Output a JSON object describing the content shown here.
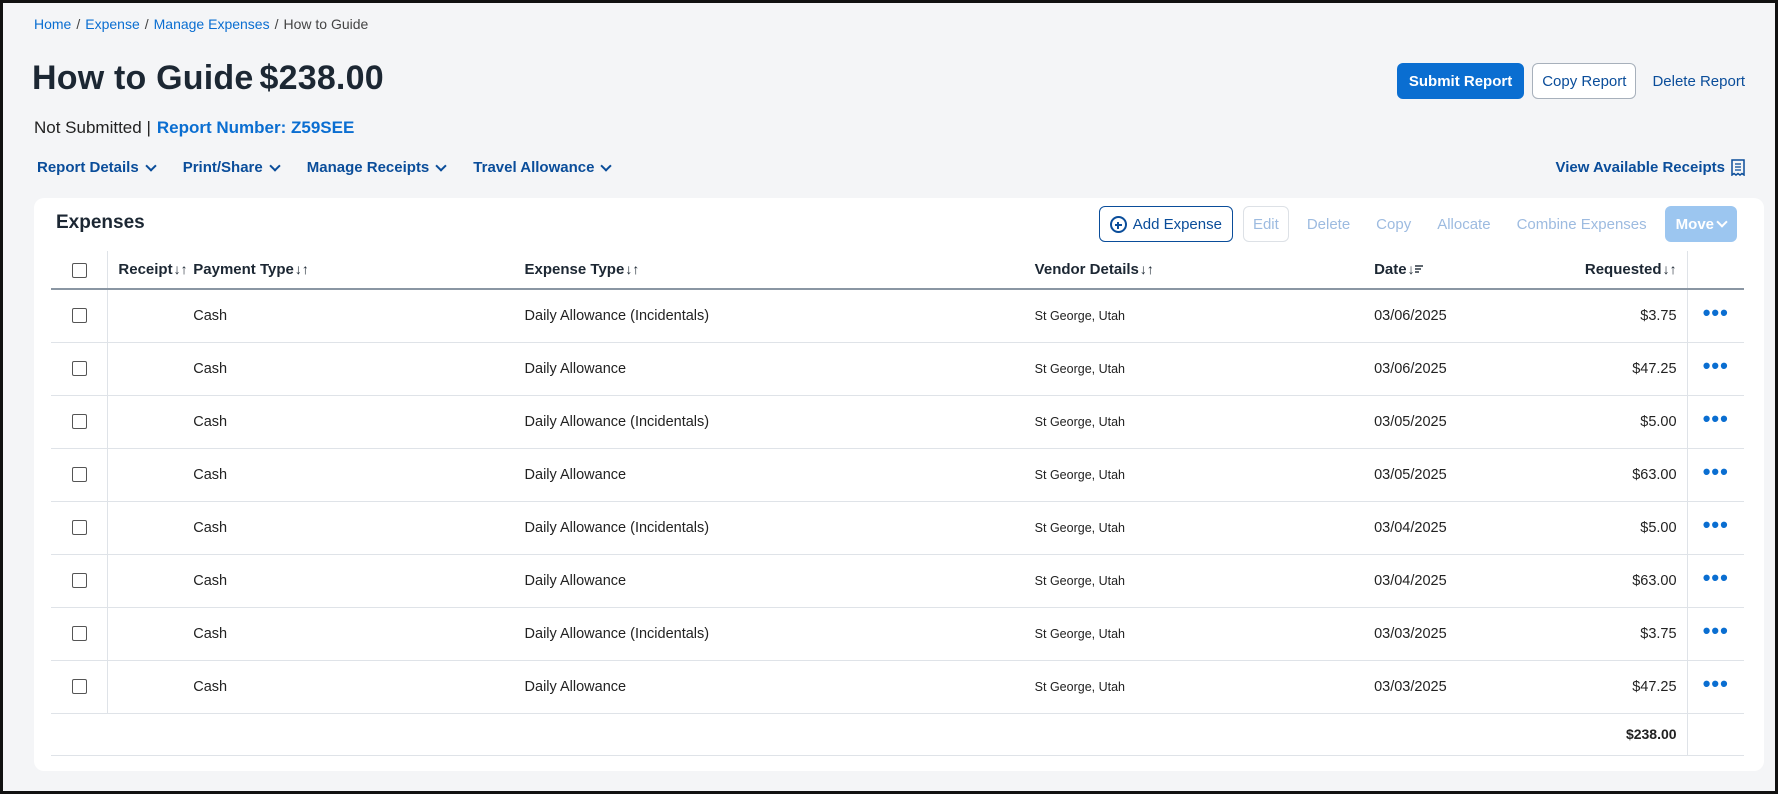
{
  "breadcrumb": {
    "items": [
      "Home",
      "Expense",
      "Manage Expenses"
    ],
    "current": "How to Guide"
  },
  "report": {
    "title": "How to Guide",
    "amount": "$238.00",
    "status": "Not Submitted |",
    "number_label": "Report Number: Z59SEE"
  },
  "actions": {
    "submit": "Submit Report",
    "copy": "Copy Report",
    "delete": "Delete Report"
  },
  "menus": [
    "Report Details",
    "Print/Share",
    "Manage Receipts",
    "Travel Allowance"
  ],
  "view_receipts": "View Available Receipts",
  "expenses": {
    "title": "Expenses",
    "toolbar": {
      "add": "Add Expense",
      "edit": "Edit",
      "delete": "Delete",
      "copy": "Copy",
      "allocate": "Allocate",
      "combine": "Combine Expenses",
      "move": "Move"
    },
    "columns": {
      "receipt": "Receipt",
      "payment_type": "Payment Type",
      "expense_type": "Expense Type",
      "vendor": "Vendor Details",
      "date": "Date",
      "requested": "Requested"
    },
    "sort_glyphs": {
      "both": "↓↑",
      "desc": "↓"
    },
    "rows": [
      {
        "payment": "Cash",
        "type": "Daily Allowance (Incidentals)",
        "vendor": "St George, Utah",
        "date": "03/06/2025",
        "amount": "$3.75"
      },
      {
        "payment": "Cash",
        "type": "Daily Allowance",
        "vendor": "St George, Utah",
        "date": "03/06/2025",
        "amount": "$47.25"
      },
      {
        "payment": "Cash",
        "type": "Daily Allowance (Incidentals)",
        "vendor": "St George, Utah",
        "date": "03/05/2025",
        "amount": "$5.00"
      },
      {
        "payment": "Cash",
        "type": "Daily Allowance",
        "vendor": "St George, Utah",
        "date": "03/05/2025",
        "amount": "$63.00"
      },
      {
        "payment": "Cash",
        "type": "Daily Allowance (Incidentals)",
        "vendor": "St George, Utah",
        "date": "03/04/2025",
        "amount": "$5.00"
      },
      {
        "payment": "Cash",
        "type": "Daily Allowance",
        "vendor": "St George, Utah",
        "date": "03/04/2025",
        "amount": "$63.00"
      },
      {
        "payment": "Cash",
        "type": "Daily Allowance (Incidentals)",
        "vendor": "St George, Utah",
        "date": "03/03/2025",
        "amount": "$3.75"
      },
      {
        "payment": "Cash",
        "type": "Daily Allowance",
        "vendor": "St George, Utah",
        "date": "03/03/2025",
        "amount": "$47.25"
      }
    ],
    "total": "$238.00",
    "row_menu": "•••"
  },
  "colors": {
    "link": "#0a6ed1",
    "primary": "#0a6ed1",
    "disabled": "#9dbbe0"
  }
}
